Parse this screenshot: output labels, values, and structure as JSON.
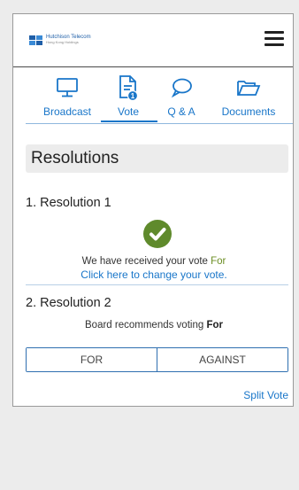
{
  "header": {
    "logo_line1": "Hutchison Telecom",
    "logo_line2": "Hong Kong Holdings"
  },
  "nav": {
    "tabs": [
      {
        "label": "Broadcast",
        "icon": "monitor-icon"
      },
      {
        "label": "Vote",
        "icon": "document-icon",
        "badge": "1"
      },
      {
        "label": "Q & A",
        "icon": "chat-bubble-icon"
      },
      {
        "label": "Documents",
        "icon": "folder-icon"
      }
    ],
    "active_tab": "Vote"
  },
  "section_title": "Resolutions",
  "resolutions": [
    {
      "title": "1. Resolution 1",
      "received_text": "We have received your vote",
      "received_vote": "For",
      "change_link": "Click here to change your vote."
    },
    {
      "title": "2. Resolution 2",
      "recommend_text": "Board recommends voting",
      "recommend_vote": "For",
      "options": [
        "FOR",
        "AGAINST"
      ]
    }
  ],
  "split_vote": "Split Vote",
  "colors": {
    "accent": "#1976c9",
    "check_green": "#5f8a2c",
    "header_bg": "#ececec"
  }
}
